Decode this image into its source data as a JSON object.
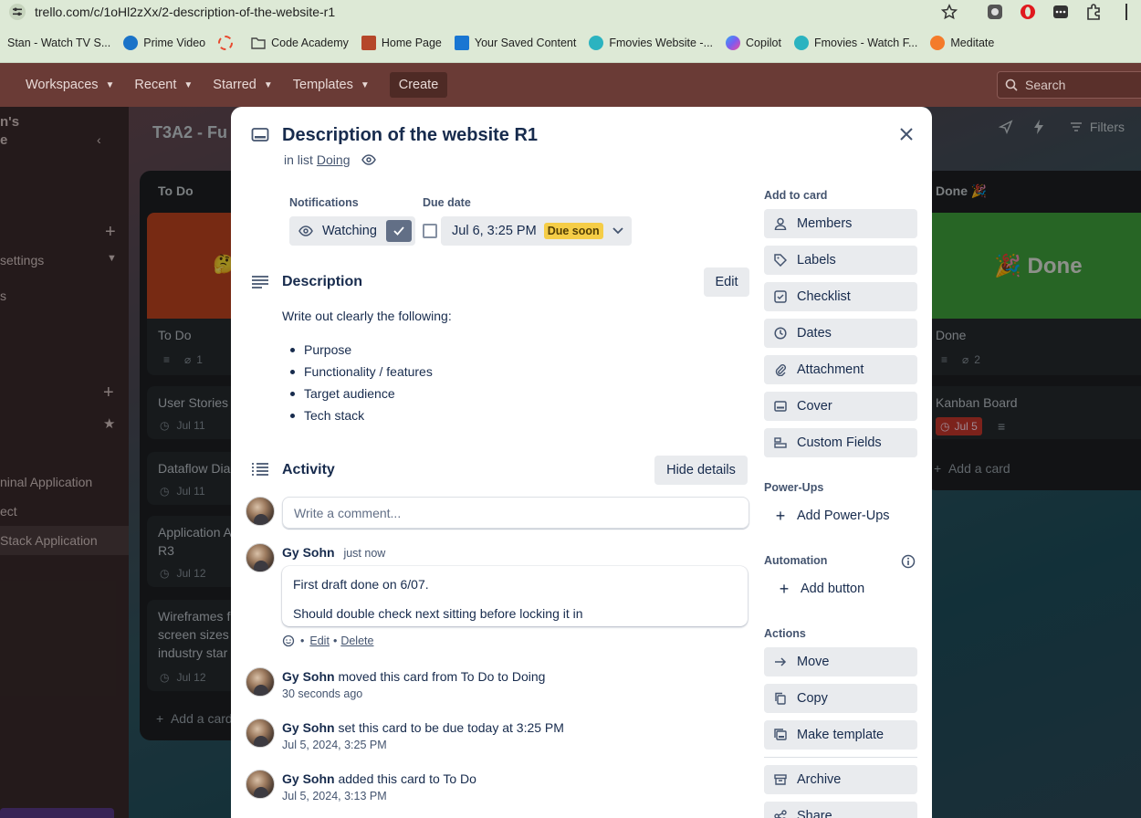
{
  "browser": {
    "url_prefix": "trello.com",
    "url_path": "/c/1oHl2zXx/2-description-of-the-website-r1",
    "bookmarks": [
      {
        "label": "Stan - Watch TV S...",
        "color": "#dde9d6"
      },
      {
        "label": "Prime Video",
        "color": "#1a73c8"
      },
      {
        "label": "",
        "color": "#e84a2f"
      },
      {
        "label": "Code Academy",
        "color": "#5f6368"
      },
      {
        "label": "Home Page",
        "color": "#b5472a"
      },
      {
        "label": "Your Saved Content",
        "color": "#1976d2"
      },
      {
        "label": "Fmovies Website -...",
        "color": "#2bb3c0"
      },
      {
        "label": "Copilot",
        "color": "#7b5cf0"
      },
      {
        "label": "Fmovies - Watch F...",
        "color": "#2bb3c0"
      },
      {
        "label": "Meditate",
        "color": "#f47b2a"
      }
    ]
  },
  "header": {
    "nav": [
      "Workspaces",
      "Recent",
      "Starred",
      "Templates"
    ],
    "create": "Create",
    "search_placeholder": "Search"
  },
  "sidebar": {
    "items": [
      "n's",
      "e",
      "settings",
      "s",
      "ninal Application",
      "ect",
      "Stack Application"
    ]
  },
  "board": {
    "title": "T3A2 - Fu",
    "filters": "Filters",
    "lists": {
      "todo": {
        "title": "To Do",
        "cards": [
          {
            "title": "To Do",
            "attachments": "1"
          },
          {
            "title": "User Stories",
            "date": "Jul 11"
          },
          {
            "title": "Dataflow Dia",
            "date": "Jul 11"
          },
          {
            "title": "Application A",
            "title2": "R3",
            "date": "Jul 12"
          },
          {
            "title": "Wireframes f",
            "title2": "screen sizes",
            "title3": "industry star",
            "date": "Jul 12"
          }
        ],
        "add": "Add a card"
      },
      "done": {
        "title": "Done 🎉",
        "cover_text": "🎉 Done",
        "cards": [
          {
            "title": "Done",
            "attachments": "2"
          },
          {
            "title": "Kanban Board",
            "date": "Jul 5"
          }
        ],
        "add": "Add a card"
      }
    }
  },
  "modal": {
    "title": "Description of the website R1",
    "in_list_prefix": "in list",
    "list_name": "Doing",
    "notifications_label": "Notifications",
    "watching": "Watching",
    "due_label": "Due date",
    "due_value": "Jul 6, 3:25 PM",
    "due_badge": "Due soon",
    "description_heading": "Description",
    "edit": "Edit",
    "description_intro": "Write out clearly the following:",
    "description_items": [
      "Purpose",
      "Functionality / features",
      "Target audience",
      "Tech stack"
    ],
    "activity_heading": "Activity",
    "hide_details": "Hide details",
    "comment_placeholder": "Write a comment...",
    "comment": {
      "author": "Gy Sohn",
      "time": "just now",
      "line1": "First draft done on 6/07.",
      "line2": "Should double check next sitting before locking it in",
      "edit": "Edit",
      "delete": "Delete"
    },
    "activities": [
      {
        "author": "Gy Sohn",
        "text": "moved this card from To Do to Doing",
        "time": "30 seconds ago"
      },
      {
        "author": "Gy Sohn",
        "text": "set this card to be due today at 3:25 PM",
        "time": "Jul 5, 2024, 3:25 PM"
      },
      {
        "author": "Gy Sohn",
        "text": "added this card to To Do",
        "time": "Jul 5, 2024, 3:13 PM"
      }
    ],
    "side": {
      "add_to_card": "Add to card",
      "add_buttons": [
        "Members",
        "Labels",
        "Checklist",
        "Dates",
        "Attachment",
        "Cover",
        "Custom Fields"
      ],
      "powerups_label": "Power-Ups",
      "add_powerups": "Add Power-Ups",
      "automation_label": "Automation",
      "add_button": "Add button",
      "actions_label": "Actions",
      "actions": [
        "Move",
        "Copy",
        "Make template"
      ],
      "archive": "Archive",
      "share": "Share"
    }
  },
  "colors": {
    "todo_cover": "#c0451f",
    "done_cover": "#3fa33d",
    "due_badge": "#f5cd47",
    "kanban_badge": "#c9372c"
  }
}
